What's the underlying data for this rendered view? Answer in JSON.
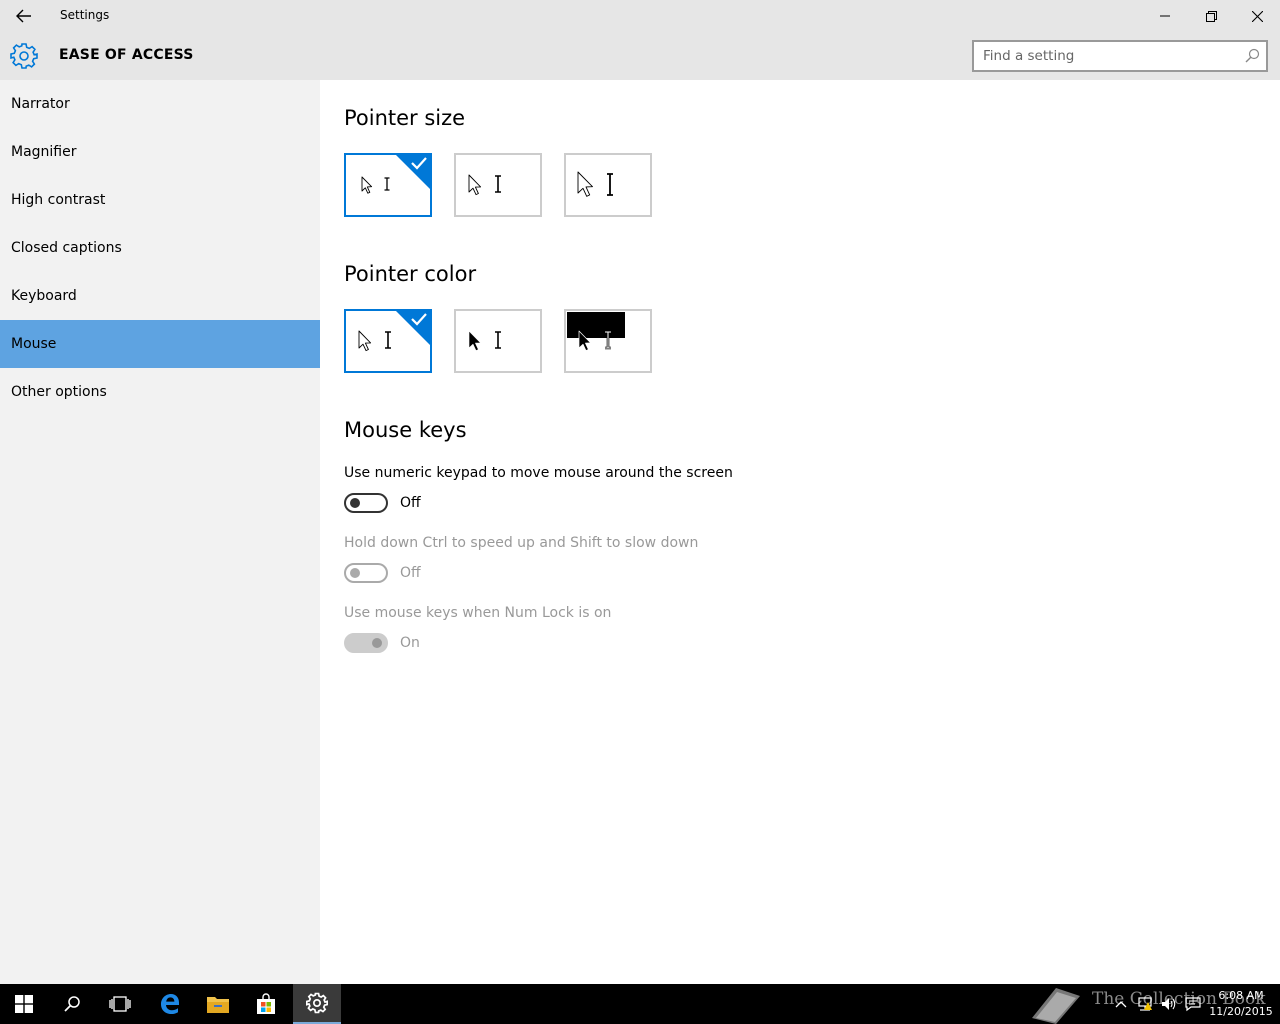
{
  "window": {
    "title": "Settings"
  },
  "header": {
    "section_title": "EASE OF ACCESS",
    "search_placeholder": "Find a setting"
  },
  "sidebar": {
    "items": [
      {
        "label": "Narrator"
      },
      {
        "label": "Magnifier"
      },
      {
        "label": "High contrast"
      },
      {
        "label": "Closed captions"
      },
      {
        "label": "Keyboard"
      },
      {
        "label": "Mouse",
        "selected": true
      },
      {
        "label": "Other options"
      }
    ]
  },
  "main": {
    "pointer_size": {
      "heading": "Pointer size",
      "options": 3,
      "selected_index": 0
    },
    "pointer_color": {
      "heading": "Pointer color",
      "options": 3,
      "selected_index": 0
    },
    "mouse_keys": {
      "heading": "Mouse keys",
      "settings": [
        {
          "label": "Use numeric keypad to move mouse around the screen",
          "state": "Off",
          "enabled": true
        },
        {
          "label": "Hold down Ctrl to speed up and Shift to slow down",
          "state": "Off",
          "enabled": false
        },
        {
          "label": "Use mouse keys when Num Lock is on",
          "state": "On",
          "enabled": false
        }
      ]
    }
  },
  "taskbar": {
    "apps": [
      "start-icon",
      "search-icon",
      "task-view-icon",
      "edge-icon",
      "file-explorer-icon",
      "store-icon",
      "settings-icon"
    ],
    "active_app": "settings-icon",
    "watermark": "The Collection Book",
    "time": "6:08 AM",
    "date": "11/20/2015"
  },
  "colors": {
    "accent": "#0078d7",
    "nav_selected": "#5ea3e1",
    "chrome": "#e6e6e6",
    "sidebar": "#f2f2f2"
  }
}
